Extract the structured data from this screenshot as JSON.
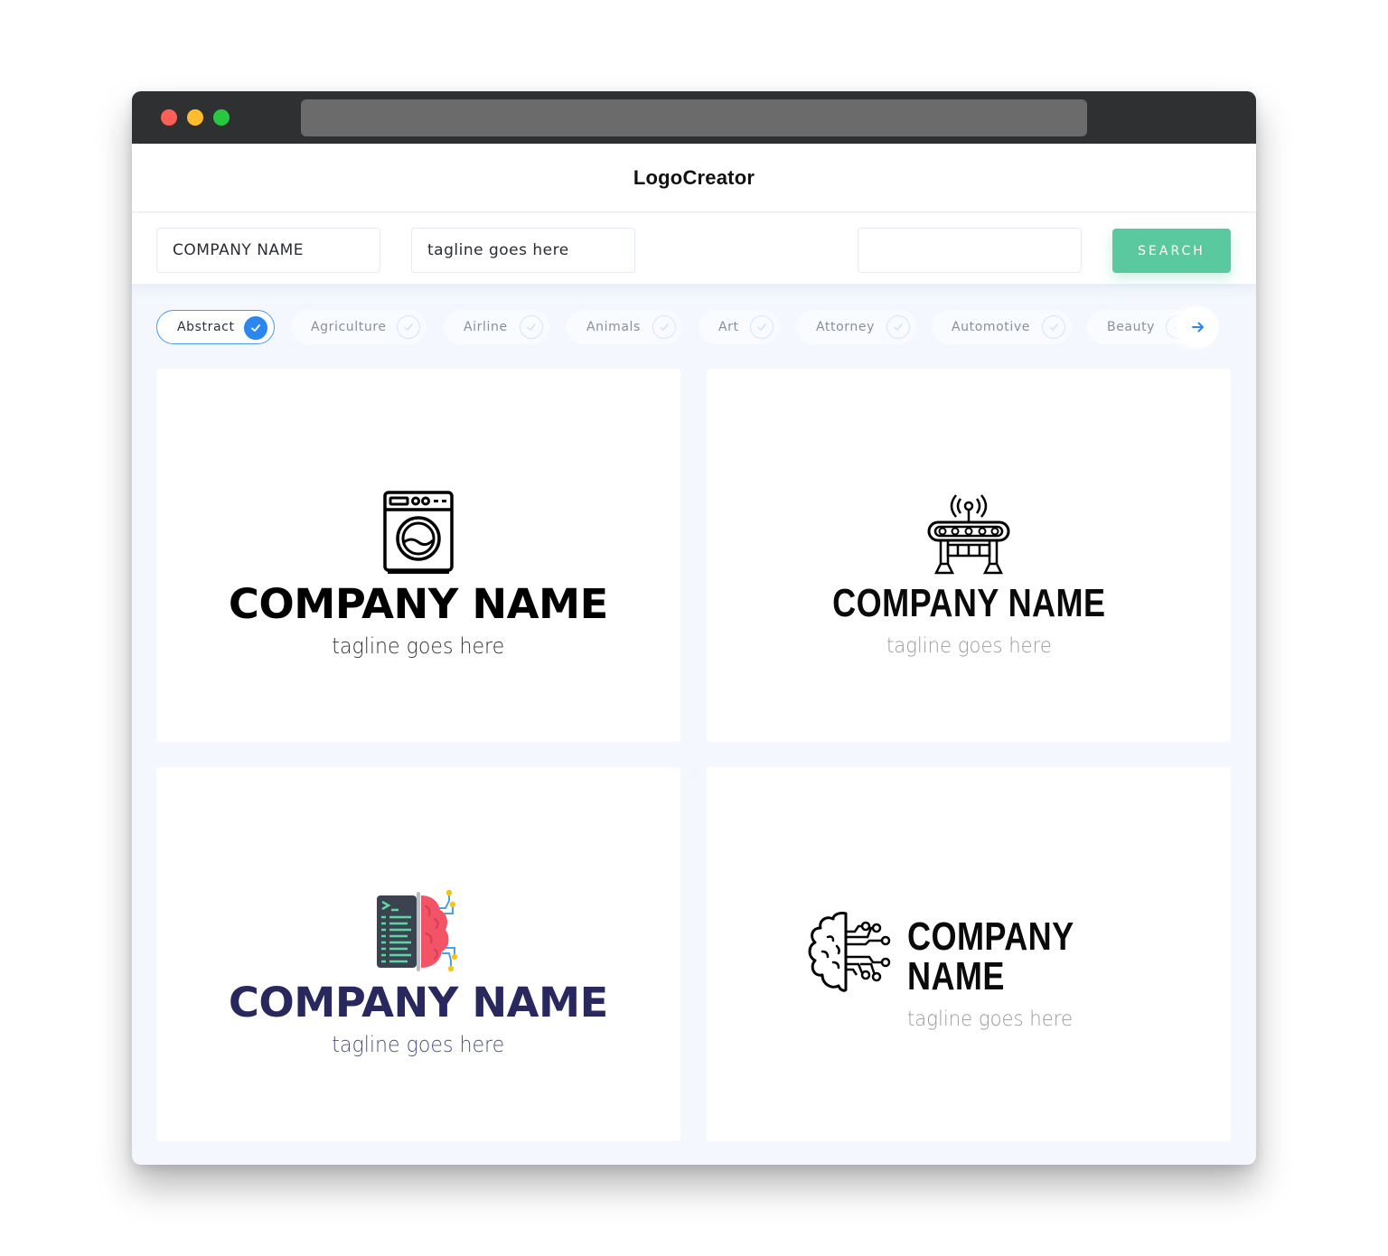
{
  "window": {
    "controls": [
      "close",
      "minimize",
      "maximize"
    ]
  },
  "header": {
    "brand": "LogoCreator"
  },
  "search": {
    "company_value": "COMPANY NAME",
    "tagline_value": "tagline goes here",
    "extra_value": "",
    "button_label": "SEARCH",
    "button_color": "#5bc9a0"
  },
  "categories": {
    "items": [
      {
        "label": "Abstract",
        "selected": true
      },
      {
        "label": "Agriculture",
        "selected": false
      },
      {
        "label": "Airline",
        "selected": false
      },
      {
        "label": "Animals",
        "selected": false
      },
      {
        "label": "Art",
        "selected": false
      },
      {
        "label": "Attorney",
        "selected": false
      },
      {
        "label": "Automotive",
        "selected": false
      },
      {
        "label": "Beauty",
        "selected": false
      }
    ],
    "next_icon": "arrow-right-icon",
    "accent_color": "#2b86ee"
  },
  "logos": [
    {
      "icon": "washing-machine-icon",
      "company_name": "COMPANY NAME",
      "tagline": "tagline goes here",
      "name_color": "#000000",
      "tagline_color": "#333333"
    },
    {
      "icon": "conveyor-antenna-icon",
      "company_name": "COMPANY NAME",
      "tagline": "tagline goes here",
      "name_color": "#0a0a0a",
      "tagline_color": "#9a9a9a"
    },
    {
      "icon": "code-brain-icon",
      "company_name": "COMPANY NAME",
      "tagline": "tagline goes here",
      "name_color": "#28285e",
      "tagline_color": "#4e4f82"
    },
    {
      "icon": "circuit-brain-icon",
      "company_name": "COMPANY NAME",
      "tagline": "tagline goes here",
      "name_color": "#0a0a0a",
      "tagline_color": "#9a9a9a"
    }
  ]
}
